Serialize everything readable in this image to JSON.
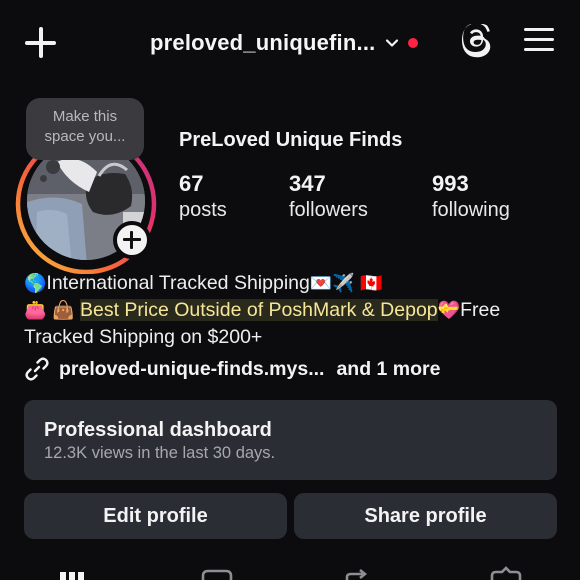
{
  "header": {
    "username": "preloved_uniquefin...",
    "create_icon": "plus-icon",
    "dropdown_icon": "chevron-down-icon",
    "notification_color": "#ff2343",
    "threads_icon": "threads-icon",
    "menu_icon": "hamburger-menu-icon"
  },
  "profile": {
    "note_placeholder": "Make this space you...",
    "display_name": "PreLoved Unique Finds",
    "stats": [
      {
        "value": "67",
        "label": "posts"
      },
      {
        "value": "347",
        "label": "followers"
      },
      {
        "value": "993",
        "label": "following"
      }
    ],
    "story_ring_colors": [
      "#f9c33b",
      "#f7693a",
      "#e1306c",
      "#c13584"
    ]
  },
  "bio": {
    "line1_prefix_emoji": "🌎",
    "line1_text": "International Tracked Shipping",
    "line1_suffix_emoji": "💌✈️ 🇨🇦",
    "line2_prefix_emoji": "👛 👜",
    "line2_highlight": "Best Price Outside of PoshMark & Depop",
    "line2_emoji": "💝",
    "line2_text": "Free",
    "line3_text": "Tracked Shipping on $200+"
  },
  "links": {
    "primary": "preloved-unique-finds.mys...",
    "more": "and 1 more",
    "icon": "link-icon"
  },
  "dashboard": {
    "title": "Professional dashboard",
    "subtitle": "12.3K views in the last 30 days."
  },
  "actions": {
    "edit_label": "Edit profile",
    "share_label": "Share profile"
  },
  "tabs": [
    {
      "icon": "grid-icon"
    },
    {
      "icon": "reels-icon"
    },
    {
      "icon": "reposts-icon"
    },
    {
      "icon": "tagged-icon"
    }
  ]
}
